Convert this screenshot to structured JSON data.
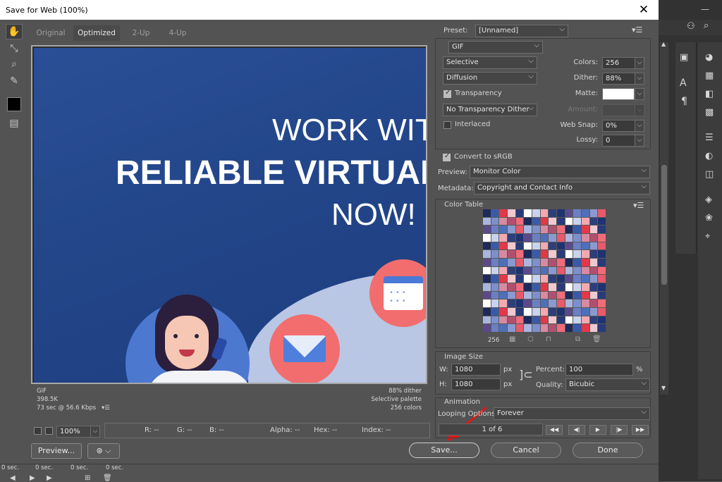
{
  "window": {
    "title": "Save for Web (100%)",
    "close": "✕"
  },
  "tabs": [
    "Original",
    "Optimized",
    "2-Up",
    "4-Up"
  ],
  "artwork": {
    "line1": "WORK WIT",
    "line2": "RELIABLE VIRTUAI",
    "line3": "NOW!"
  },
  "image_info": {
    "format": "GIF",
    "size": "398.5K",
    "time": "73 sec @ 56.6 Kbps",
    "dither": "88% dither",
    "palette": "Selective palette",
    "colors": "256 colors"
  },
  "status_bar": {
    "zoom": "100%",
    "r": "R: --",
    "g": "G: --",
    "b": "B: --",
    "alpha": "Alpha: --",
    "hex": "Hex: --",
    "index": "Index: --"
  },
  "bottom": {
    "preview": "Preview...",
    "save": "Save...",
    "cancel": "Cancel",
    "done": "Done"
  },
  "settings": {
    "preset_label": "Preset:",
    "preset": "[Unnamed]",
    "format": "GIF",
    "reduction": "Selective",
    "colors_label": "Colors:",
    "colors": "256",
    "dither_algo": "Diffusion",
    "dither_label": "Dither:",
    "dither": "88%",
    "transparency": "Transparency",
    "matte_label": "Matte:",
    "trans_dither": "No Transparency Dither",
    "amount_label": "Amount:",
    "interlaced": "Interlaced",
    "websnap_label": "Web Snap:",
    "websnap": "0%",
    "lossy_label": "Lossy:",
    "lossy": "0",
    "srgb": "Convert to sRGB",
    "preview_label": "Preview:",
    "preview_value": "Monitor Color",
    "metadata_label": "Metadata:",
    "metadata_value": "Copyright and Contact Info"
  },
  "color_table": {
    "title": "Color Table",
    "count": "256"
  },
  "image_size": {
    "title": "Image Size",
    "w_label": "W:",
    "w": "1080",
    "h_label": "H:",
    "h": "1080",
    "unit": "px",
    "percent_label": "Percent:",
    "percent": "100",
    "percent_unit": "%",
    "quality_label": "Quality:",
    "quality": "Bicubic"
  },
  "animation": {
    "title": "Animation",
    "looping_label": "Looping Options:",
    "looping": "Forever",
    "frame": "1 of 6"
  },
  "timeline": [
    "0 sec.",
    "0 sec.",
    "0 sec.",
    "0 sec."
  ],
  "palette_colors": [
    "#2d3f7a",
    "#3a5aa8",
    "#e65a6a",
    "#f2a9b0",
    "#1c2a5c",
    "#8a9ad0",
    "#c9d3ee",
    "#f06c7a",
    "#4f6fb8",
    "#ffffff",
    "#b05070",
    "#6a7fc4",
    "#283a78",
    "#d88aa0",
    "#5b4a8a",
    "#efc8d0",
    "#7d8fcc",
    "#1f3370",
    "#e23848",
    "#a8b6e0"
  ],
  "accent": "#f26d6d"
}
